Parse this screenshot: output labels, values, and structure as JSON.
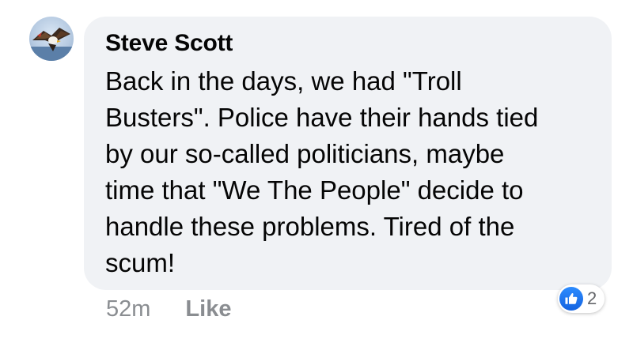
{
  "comment": {
    "author": "Steve Scott",
    "text": "Back in the days, we had \"Troll\nBusters\". Police have their hands tied\nby our so-called politicians, maybe\ntime that \"We The People\" decide to\nhandle these problems. Tired of the\nscum!",
    "timestamp": "52m",
    "like_label": "Like",
    "reaction_count": "2",
    "reaction_icon": "thumbs-up-icon",
    "avatar_icon": "eagle-icon"
  },
  "colors": {
    "bubble_bg": "#f0f2f5",
    "text": "#050505",
    "meta_text": "#8a8d91",
    "like_blue": "#1877f2"
  }
}
